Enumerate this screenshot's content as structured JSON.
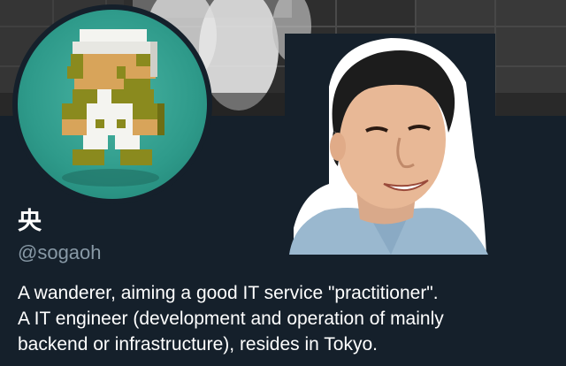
{
  "profile": {
    "display_name": "央",
    "handle": "@sogaoh",
    "bio_lines": [
      "A wanderer, aiming a good IT service \"practitioner\".",
      "A IT engineer (development and operation of mainly",
      "backend or infrastructure), resides in Tokyo."
    ]
  },
  "colors": {
    "background": "#15202b",
    "text_primary": "#ffffff",
    "text_secondary": "#8899a6",
    "avatar_background": "#2e9a8a"
  },
  "icons": {
    "avatar": "pixel-plumber-character-icon"
  }
}
